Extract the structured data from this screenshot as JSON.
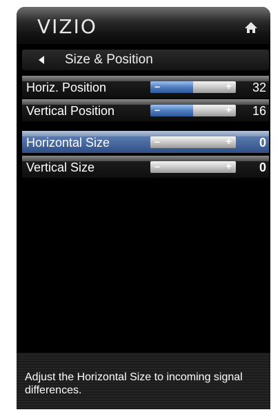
{
  "header": {
    "logo": "VIZIO",
    "home_icon": "home-icon"
  },
  "title_row": {
    "back_icon": "back-arrow-icon",
    "title": "Size & Position"
  },
  "menu": {
    "items": [
      {
        "label": "Horiz. Position",
        "value": "32",
        "level": 0.5,
        "selected": false
      },
      {
        "label": "Vertical Position",
        "value": "16",
        "level": 0.5,
        "selected": false
      },
      {
        "label": "Horizontal Size",
        "value": "0",
        "level": 0.0,
        "selected": true
      },
      {
        "label": "Vertical Size",
        "value": "0",
        "level": 0.0,
        "selected": false
      }
    ],
    "minus_symbol": "−",
    "plus_symbol": "+"
  },
  "footer": {
    "help_text": "Adjust the Horizontal Size to incoming signal differences."
  },
  "colors": {
    "selected_row": "#3f62a0",
    "slider_fill": "#4f7dc0",
    "background": "#000000"
  }
}
